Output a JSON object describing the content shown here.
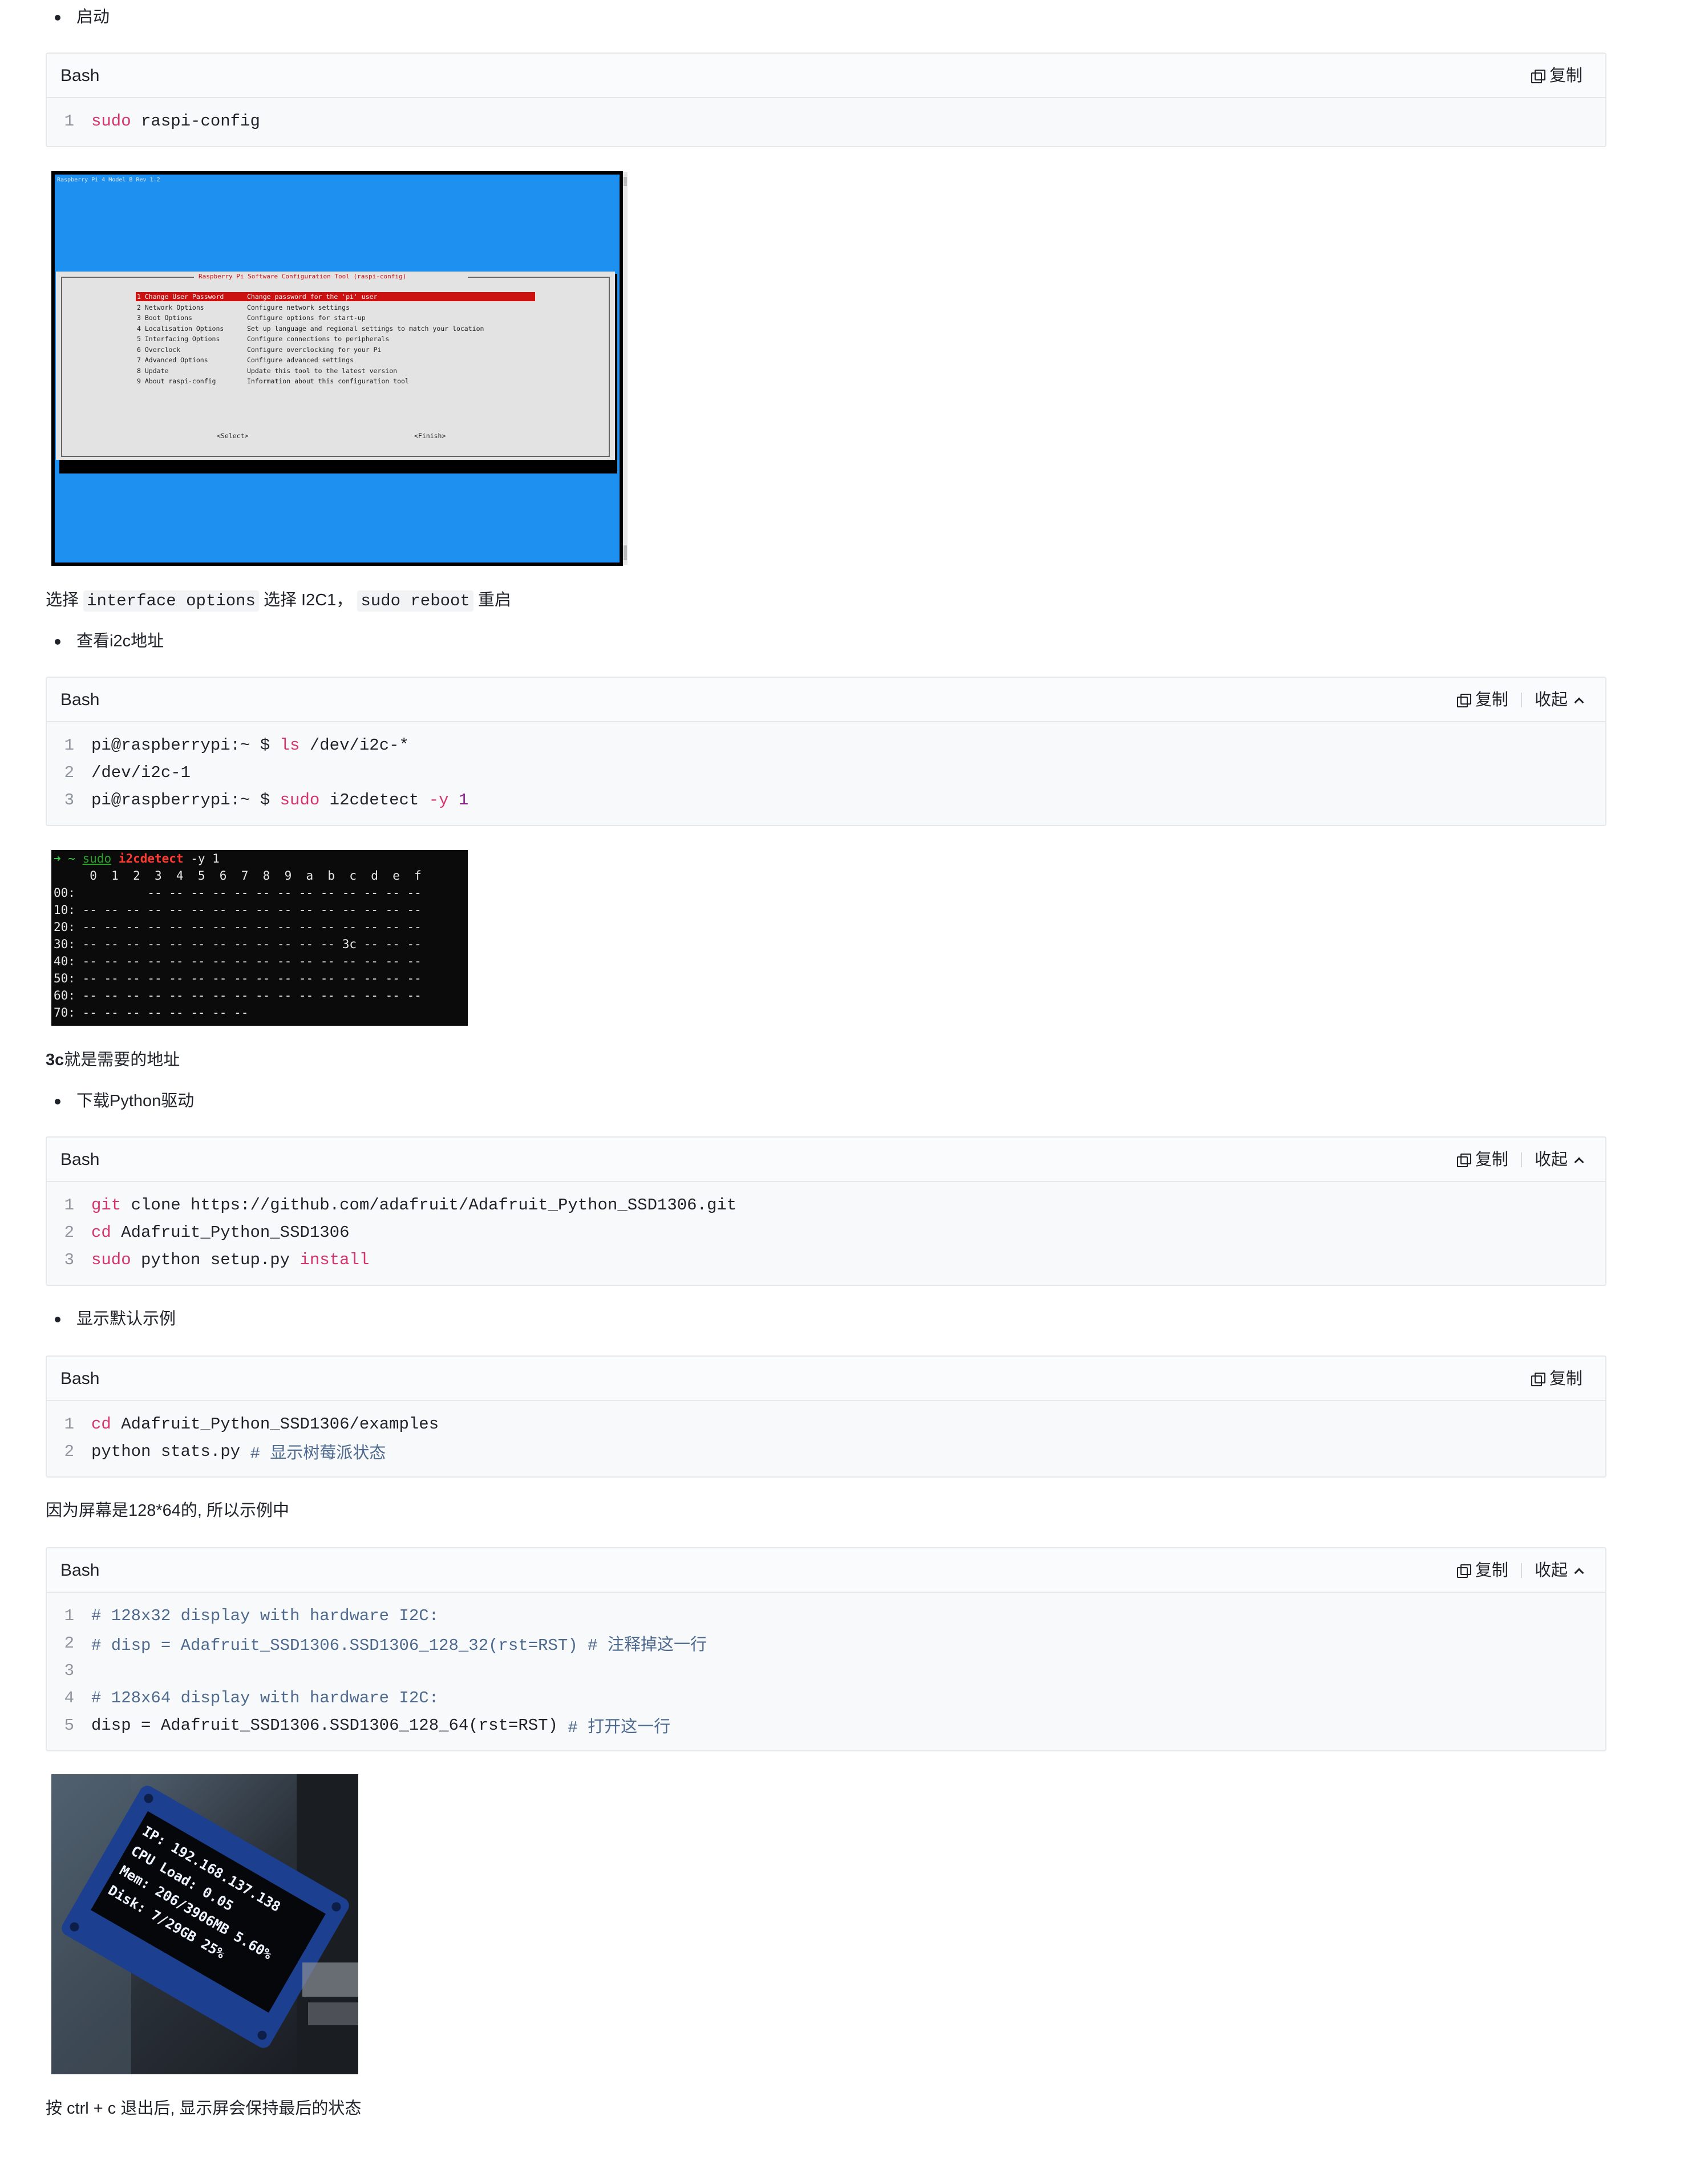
{
  "items": {
    "start": "启动",
    "check_i2c": "查看i2c地址",
    "download_driver": "下载Python驱动",
    "show_example": "显示默认示例"
  },
  "texts": {
    "select_pre": "选择",
    "select_code1": "interface options",
    "select_mid": "选择 I2C1，",
    "select_code2": "sudo reboot",
    "select_post": "重启",
    "address_bold": "3c",
    "address_rest": "就是需要的地址",
    "screen_note": "因为屏幕是128*64的, 所以示例中",
    "exit_note": "按 ctrl + c 退出后, 显示屏会保持最后的状态"
  },
  "ui": {
    "lang": "Bash",
    "copy": "复制",
    "collapse": "收起"
  },
  "code1": [
    {
      "n": "1",
      "a": "sudo",
      "b": " raspi-config"
    }
  ],
  "code2": [
    {
      "n": "1",
      "a": "pi@raspberrypi:~ $ ",
      "b": "ls",
      "c": " /dev/i2c-*"
    },
    {
      "n": "2",
      "a": "/dev/i2c-1"
    },
    {
      "n": "3",
      "a": "pi@raspberrypi:~ $ ",
      "b": "sudo",
      "c": " i2cdetect ",
      "d": "-y",
      "e": " 1"
    }
  ],
  "code3": [
    {
      "n": "1",
      "a": "git",
      "b": " clone https://github.com/adafruit/Adafruit_Python_SSD1306.git"
    },
    {
      "n": "2",
      "a": "cd",
      "b": " Adafruit_Python_SSD1306"
    },
    {
      "n": "3",
      "a": "sudo",
      "b": " python setup.py ",
      "c": "install"
    }
  ],
  "code4": [
    {
      "n": "1",
      "a": "cd",
      "b": " Adafruit_Python_SSD1306/examples"
    },
    {
      "n": "2",
      "a": "python stats.py ",
      "b": "# 显示树莓派状态"
    }
  ],
  "code5": [
    {
      "n": "1",
      "a": "# 128x32 display with hardware I2C:"
    },
    {
      "n": "2",
      "a": "# disp = Adafruit_SSD1306.SSD1306_128_32(rst=RST) # 注释掉这一行"
    },
    {
      "n": "3",
      "a": ""
    },
    {
      "n": "4",
      "a": "# 128x64 display with hardware I2C:"
    },
    {
      "n": "5",
      "a": "disp = Adafruit_SSD1306.SSD1306_128_64(rst=RST) ",
      "b": "# 打开这一行"
    }
  ],
  "raspi": {
    "header": "Raspberry Pi 4 Model B Rev 1.2",
    "title": "Raspberry Pi Software Configuration Tool (raspi-config)",
    "menu": [
      {
        "name": "1 Change User Password",
        "desc": "Change password for the 'pi' user"
      },
      {
        "name": "2 Network Options",
        "desc": "Configure network settings"
      },
      {
        "name": "3 Boot Options",
        "desc": "Configure options for start-up"
      },
      {
        "name": "4 Localisation Options",
        "desc": "Set up language and regional settings to match your location"
      },
      {
        "name": "5 Interfacing Options",
        "desc": "Configure connections to peripherals"
      },
      {
        "name": "6 Overclock",
        "desc": "Configure overclocking for your Pi"
      },
      {
        "name": "7 Advanced Options",
        "desc": "Configure advanced settings"
      },
      {
        "name": "8 Update",
        "desc": "Update this tool to the latest version"
      },
      {
        "name": "9 About raspi-config",
        "desc": "Information about this configuration tool"
      }
    ],
    "select": "<Select>",
    "finish": "<Finish>"
  },
  "term": {
    "prompt": "➜  ~ ",
    "cmd_sudo": "sudo",
    "cmd_name": " i2cdetect",
    "cmd_args": " -y 1",
    "header": "     0  1  2  3  4  5  6  7  8  9  a  b  c  d  e  f",
    "rows": [
      "00:          -- -- -- -- -- -- -- -- -- -- -- -- --",
      "10: -- -- -- -- -- -- -- -- -- -- -- -- -- -- -- --",
      "20: -- -- -- -- -- -- -- -- -- -- -- -- -- -- -- --",
      "30: -- -- -- -- -- -- -- -- -- -- -- -- 3c -- -- --",
      "40: -- -- -- -- -- -- -- -- -- -- -- -- -- -- -- --",
      "50: -- -- -- -- -- -- -- -- -- -- -- -- -- -- -- --",
      "60: -- -- -- -- -- -- -- -- -- -- -- -- -- -- -- --",
      "70: -- -- -- -- -- -- -- --"
    ]
  },
  "oled": {
    "lines": [
      "IP: 192.168.137.138",
      "CPU Load: 0.05",
      "Mem: 206/3906MB 5.60%",
      "Disk: 7/29GB 25%"
    ]
  }
}
